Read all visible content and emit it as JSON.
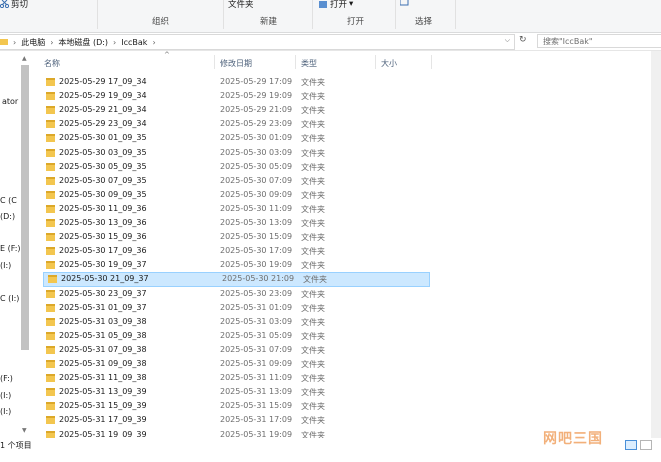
{
  "ribbon": {
    "cut_label": "剪切",
    "organize_label": "组织",
    "new_label": "新建",
    "open_group_label": "打开",
    "select_label": "选择",
    "folder_label": "文件夹",
    "open_button_label": "打开"
  },
  "address": {
    "crumbs": [
      "此电脑",
      "本地磁盘 (D:)",
      "IccBak"
    ],
    "search_placeholder": "搜索\"IccBak\""
  },
  "columns": {
    "name": "名称",
    "date": "修改日期",
    "type": "类型",
    "size": "大小"
  },
  "nav_items": [
    "ator",
    "C (C",
    "(D:)",
    "E (F:)",
    "(I:)",
    "C (I:)",
    "(F:)",
    "(I:)",
    "(I:)"
  ],
  "files": [
    {
      "name": "2025-05-29 17_09_34",
      "date": "2025-05-29 17:09",
      "type": "文件夹"
    },
    {
      "name": "2025-05-29 19_09_34",
      "date": "2025-05-29 19:09",
      "type": "文件夹"
    },
    {
      "name": "2025-05-29 21_09_34",
      "date": "2025-05-29 21:09",
      "type": "文件夹"
    },
    {
      "name": "2025-05-29 23_09_34",
      "date": "2025-05-29 23:09",
      "type": "文件夹"
    },
    {
      "name": "2025-05-30 01_09_35",
      "date": "2025-05-30 01:09",
      "type": "文件夹"
    },
    {
      "name": "2025-05-30 03_09_35",
      "date": "2025-05-30 03:09",
      "type": "文件夹"
    },
    {
      "name": "2025-05-30 05_09_35",
      "date": "2025-05-30 05:09",
      "type": "文件夹"
    },
    {
      "name": "2025-05-30 07_09_35",
      "date": "2025-05-30 07:09",
      "type": "文件夹"
    },
    {
      "name": "2025-05-30 09_09_35",
      "date": "2025-05-30 09:09",
      "type": "文件夹"
    },
    {
      "name": "2025-05-30 11_09_36",
      "date": "2025-05-30 11:09",
      "type": "文件夹"
    },
    {
      "name": "2025-05-30 13_09_36",
      "date": "2025-05-30 13:09",
      "type": "文件夹"
    },
    {
      "name": "2025-05-30 15_09_36",
      "date": "2025-05-30 15:09",
      "type": "文件夹"
    },
    {
      "name": "2025-05-30 17_09_36",
      "date": "2025-05-30 17:09",
      "type": "文件夹"
    },
    {
      "name": "2025-05-30 19_09_37",
      "date": "2025-05-30 19:09",
      "type": "文件夹"
    },
    {
      "name": "2025-05-30 21_09_37",
      "date": "2025-05-30 21:09",
      "type": "文件夹",
      "selected": true
    },
    {
      "name": "2025-05-30 23_09_37",
      "date": "2025-05-30 23:09",
      "type": "文件夹"
    },
    {
      "name": "2025-05-31 01_09_37",
      "date": "2025-05-31 01:09",
      "type": "文件夹"
    },
    {
      "name": "2025-05-31 03_09_38",
      "date": "2025-05-31 03:09",
      "type": "文件夹"
    },
    {
      "name": "2025-05-31 05_09_38",
      "date": "2025-05-31 05:09",
      "type": "文件夹"
    },
    {
      "name": "2025-05-31 07_09_38",
      "date": "2025-05-31 07:09",
      "type": "文件夹"
    },
    {
      "name": "2025-05-31 09_09_38",
      "date": "2025-05-31 09:09",
      "type": "文件夹"
    },
    {
      "name": "2025-05-31 11_09_38",
      "date": "2025-05-31 11:09",
      "type": "文件夹"
    },
    {
      "name": "2025-05-31 13_09_39",
      "date": "2025-05-31 13:09",
      "type": "文件夹"
    },
    {
      "name": "2025-05-31 15_09_39",
      "date": "2025-05-31 15:09",
      "type": "文件夹"
    },
    {
      "name": "2025-05-31 17_09_39",
      "date": "2025-05-31 17:09",
      "type": "文件夹"
    },
    {
      "name": "2025-05-31 19_09_39",
      "date": "2025-05-31 19:09",
      "type": "文件夹"
    }
  ],
  "status": {
    "text": "1 个项目"
  },
  "watermark": "网吧三国",
  "colors": {
    "selection": "#cce8ff",
    "folder": "#f3c64f",
    "header_text": "#4c607a"
  }
}
